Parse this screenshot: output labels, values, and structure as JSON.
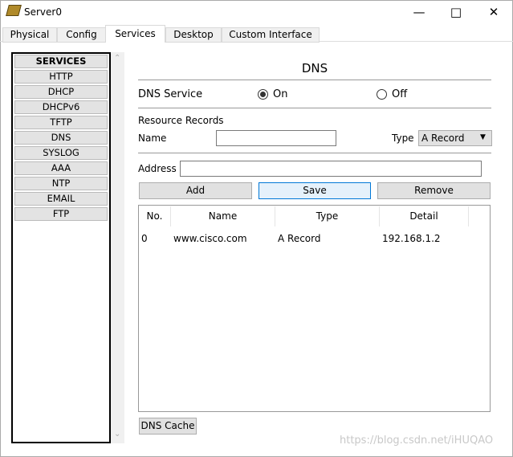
{
  "window": {
    "title": "Server0",
    "icon": "server-icon",
    "controls": [
      "minimize-icon",
      "maximize-icon",
      "close-icon"
    ]
  },
  "tabs": [
    {
      "label": "Physical"
    },
    {
      "label": "Config"
    },
    {
      "label": "Services",
      "active": true
    },
    {
      "label": "Desktop"
    },
    {
      "label": "Custom Interface"
    }
  ],
  "sidebar": {
    "header": "SERVICES",
    "items": [
      "HTTP",
      "DHCP",
      "DHCPv6",
      "TFTP",
      "DNS",
      "SYSLOG",
      "AAA",
      "NTP",
      "EMAIL",
      "FTP"
    ]
  },
  "dns": {
    "heading": "DNS",
    "service_label": "DNS Service",
    "on_label": "On",
    "off_label": "Off",
    "service_state": "On",
    "resource_records_label": "Resource Records",
    "name_label": "Name",
    "name_value": "",
    "type_label": "Type",
    "type_value": "A Record",
    "address_label": "Address",
    "address_value": "",
    "add_label": "Add",
    "save_label": "Save",
    "remove_label": "Remove",
    "table": {
      "columns": [
        "No.",
        "Name",
        "Type",
        "Detail"
      ],
      "rows": [
        [
          "0",
          "www.cisco.com",
          "A Record",
          "192.168.1.2"
        ]
      ]
    },
    "cache_label": "DNS Cache"
  },
  "watermark": "https://blog.csdn.net/iHUQAO"
}
